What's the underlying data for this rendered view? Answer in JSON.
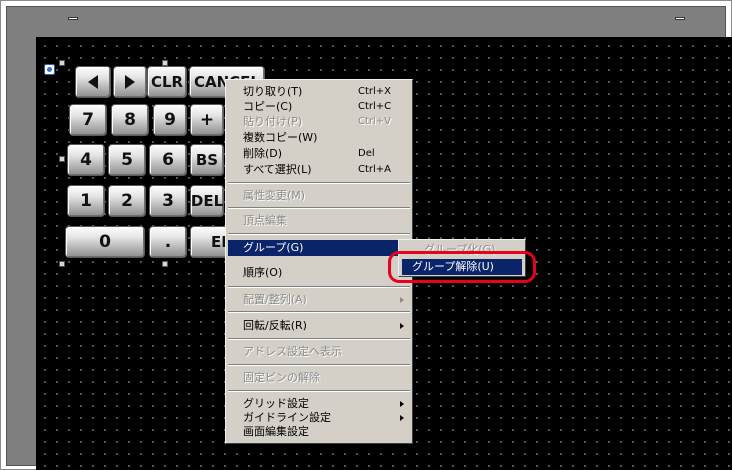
{
  "keypad": {
    "rows": [
      [
        {
          "label": "",
          "icon": "arrow-left-icon"
        },
        {
          "label": "",
          "icon": "arrow-right-icon"
        },
        {
          "label": "CLR"
        },
        {
          "label": "CANCEL"
        }
      ],
      [
        {
          "label": "7"
        },
        {
          "label": "8"
        },
        {
          "label": "9"
        },
        {
          "label": "+"
        }
      ],
      [
        {
          "label": "4"
        },
        {
          "label": "5"
        },
        {
          "label": "6"
        },
        {
          "label": "BS"
        }
      ],
      [
        {
          "label": "1"
        },
        {
          "label": "2"
        },
        {
          "label": "3"
        },
        {
          "label": "DEL"
        }
      ],
      [
        {
          "label": "0"
        },
        {
          "label": "."
        },
        {
          "label": "ENT"
        }
      ]
    ]
  },
  "context_menu": {
    "cut": {
      "label": "切り取り(T)",
      "shortcut": "Ctrl+X"
    },
    "copy": {
      "label": "コピー(C)",
      "shortcut": "Ctrl+C"
    },
    "paste": {
      "label": "貼り付け(P)",
      "shortcut": "Ctrl+V",
      "disabled": true
    },
    "multi_copy": {
      "label": "複数コピー(W)"
    },
    "delete": {
      "label": "削除(D)",
      "shortcut": "Del"
    },
    "select_all": {
      "label": "すべて選択(L)",
      "shortcut": "Ctrl+A"
    },
    "change_attr": {
      "label": "属性変更(M)",
      "disabled": true
    },
    "vertex_edit": {
      "label": "頂点編集",
      "disabled": true
    },
    "group": {
      "label": "グループ(G)",
      "selected": true
    },
    "order": {
      "label": "順序(O)"
    },
    "align": {
      "label": "配置/整列(A)",
      "disabled": true
    },
    "rotate": {
      "label": "回転/反転(R)"
    },
    "show_address": {
      "label": "アドレス設定へ表示",
      "disabled": true
    },
    "unpin": {
      "label": "固定ピンの解除",
      "disabled": true
    },
    "grid": {
      "label": "グリッド設定"
    },
    "guideline": {
      "label": "ガイドライン設定"
    },
    "screen_edit": {
      "label": "画面編集設定"
    }
  },
  "submenu": {
    "group_create": {
      "label": "グループ化(G)",
      "disabled": true
    },
    "ungroup": {
      "label": "グループ解除(U)",
      "selected": true
    }
  },
  "colors": {
    "menu_bg": "#d4d0c8",
    "selection": "#0a246a",
    "highlight_ring": "#e8001c",
    "canvas": "#000000"
  }
}
